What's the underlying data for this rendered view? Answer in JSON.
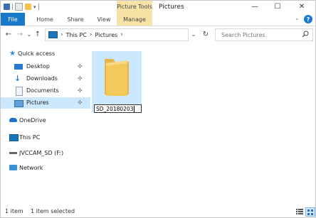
{
  "window": {
    "contextual_tab": "Picture Tools",
    "title": "Pictures",
    "minimize": "—",
    "maximize": "☐",
    "close": "✕"
  },
  "ribbon": {
    "tabs": [
      "File",
      "Home",
      "Share",
      "View",
      "Manage"
    ],
    "help": "?"
  },
  "nav": {
    "back": "←",
    "forward": "→",
    "recent": "⌄",
    "up": "↑",
    "path": [
      "This PC",
      "Pictures"
    ],
    "search_placeholder": "Search Pictures"
  },
  "sidebar": {
    "quick_access": "Quick access",
    "items": [
      {
        "label": "Desktop",
        "pinned": true
      },
      {
        "label": "Downloads",
        "pinned": true
      },
      {
        "label": "Documents",
        "pinned": true
      },
      {
        "label": "Pictures",
        "pinned": true
      }
    ],
    "onedrive": "OneDrive",
    "this_pc": "This PC",
    "drive": "JVCCAM_SD (F:)",
    "network": "Network"
  },
  "content": {
    "folder_name": "SD_20180203"
  },
  "status": {
    "item_count": "1 item",
    "selection": "1 item selected"
  },
  "colors": {
    "accent": "#1979ca",
    "contextual": "#f7e3a6",
    "selection": "#cce8ff",
    "folder": "#f5c85c"
  }
}
